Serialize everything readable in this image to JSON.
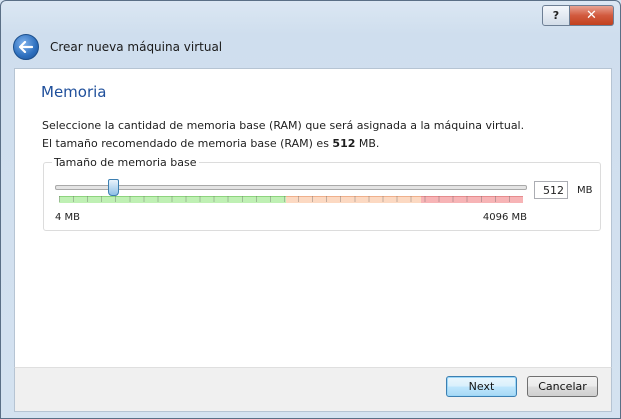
{
  "titlebar": {
    "help_label": "?",
    "close_label": "✕"
  },
  "header": {
    "title": "Crear nueva máquina virtual"
  },
  "page": {
    "title": "Memoria",
    "description": "Seleccione la cantidad de memoria base (RAM) que será asignada a la máquina virtual.",
    "recommended_prefix": "El tamaño recomendado de memoria base (RAM) es ",
    "recommended_value": "512",
    "recommended_suffix": " MB."
  },
  "memory": {
    "group_label": "Tamaño de memoria base",
    "min_label": "4 MB",
    "max_label": "4096 MB",
    "value": "512",
    "unit": "MB",
    "slider_fraction": 0.124
  },
  "footer": {
    "next_label": "Next",
    "cancel_label": "Cancelar"
  },
  "colors": {
    "accent": "#1f4f9b",
    "safe": "#bff0b4",
    "warning": "#fcd9c2",
    "danger": "#f7b4b6"
  },
  "icons": {
    "back": "back-arrow-icon"
  }
}
